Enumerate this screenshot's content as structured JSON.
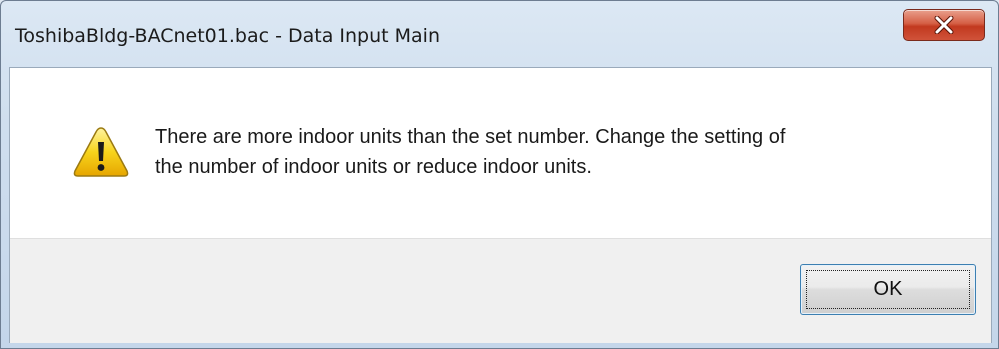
{
  "window": {
    "title": "ToshibaBldg-BACnet01.bac - Data Input Main",
    "close_icon": "close-x-icon"
  },
  "dialog": {
    "icon": "warning-icon",
    "message_line1": "There are more indoor units than the set number. Change the setting of",
    "message_line2": "the number of indoor units or reduce indoor units.",
    "ok_label": "OK"
  },
  "colors": {
    "close_button": "#c2391f",
    "warning_fill": "#f7d41c",
    "ok_border": "#3c7fb1"
  }
}
